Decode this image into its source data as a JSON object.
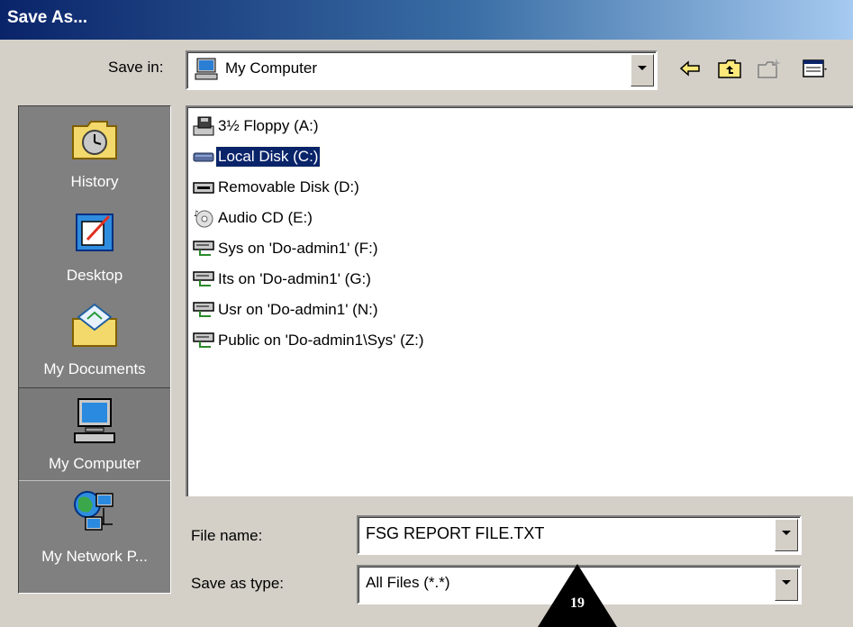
{
  "window": {
    "title": "Save As..."
  },
  "save_in": {
    "label": "Save in:",
    "value": "My Computer",
    "icon": "my-computer-icon"
  },
  "toolbar": {
    "icons": [
      "back-arrow-icon",
      "up-folder-icon",
      "new-folder-icon",
      "views-menu-icon"
    ]
  },
  "places": [
    {
      "label": "History",
      "icon": "history-icon"
    },
    {
      "label": "Desktop",
      "icon": "desktop-icon"
    },
    {
      "label": "My Documents",
      "icon": "my-documents-icon"
    },
    {
      "label": "My Computer",
      "icon": "my-computer-icon",
      "selected": true
    },
    {
      "label": "My Network P...",
      "icon": "network-places-icon"
    }
  ],
  "files": [
    {
      "label": "3½ Floppy (A:)",
      "icon": "floppy-drive-icon"
    },
    {
      "label": "Local Disk (C:)",
      "icon": "hard-disk-icon",
      "selected": true
    },
    {
      "label": "Removable Disk (D:)",
      "icon": "removable-disk-icon"
    },
    {
      "label": "Audio CD (E:)",
      "icon": "cd-drive-icon"
    },
    {
      "label": "Sys on 'Do-admin1' (F:)",
      "icon": "network-drive-icon"
    },
    {
      "label": "Its on 'Do-admin1' (G:)",
      "icon": "network-drive-icon"
    },
    {
      "label": "Usr on 'Do-admin1' (N:)",
      "icon": "network-drive-icon"
    },
    {
      "label": "Public on 'Do-admin1\\Sys' (Z:)",
      "icon": "network-drive-icon"
    }
  ],
  "file_name": {
    "label": "File name:",
    "value": "FSG REPORT FILE.TXT"
  },
  "save_as_type": {
    "label": "Save as type:",
    "value": "All Files (*.*)"
  },
  "callout": {
    "number": "19"
  },
  "colors": {
    "selection": "#0a246a",
    "title_gradient_start": "#0a246a",
    "face": "#d4d0c8"
  }
}
